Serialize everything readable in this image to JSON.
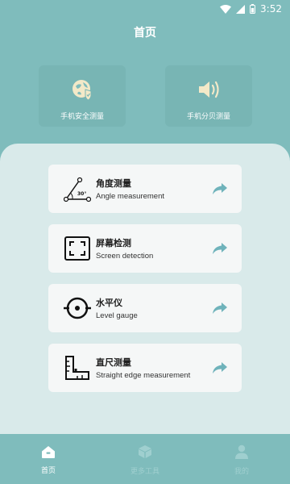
{
  "status_bar": {
    "time": "3:52"
  },
  "header": {
    "title": "首页"
  },
  "top_cards": [
    {
      "label": "手机安全测量",
      "icon": "shield-globe-icon"
    },
    {
      "label": "手机分贝测量",
      "icon": "speaker-icon"
    }
  ],
  "tools": [
    {
      "name": "角度测量",
      "subtitle": "Angle measurement",
      "icon": "angle-icon",
      "badge": "30°"
    },
    {
      "name": "屏幕检测",
      "subtitle": "Screen detection",
      "icon": "screen-frame-icon"
    },
    {
      "name": "水平仪",
      "subtitle": "Level gauge",
      "icon": "level-icon"
    },
    {
      "name": "直尺测量",
      "subtitle": "Straight edge measurement",
      "icon": "ruler-icon"
    }
  ],
  "nav": [
    {
      "label": "首页",
      "icon": "home-icon",
      "active": true
    },
    {
      "label": "更多工具",
      "icon": "box-icon",
      "active": false
    },
    {
      "label": "我的",
      "icon": "user-icon",
      "active": false
    }
  ],
  "colors": {
    "background": "#7fbcbc",
    "sheet": "#d9eaea",
    "card": "#f5f7f7",
    "arrow": "#6fb3bb"
  }
}
